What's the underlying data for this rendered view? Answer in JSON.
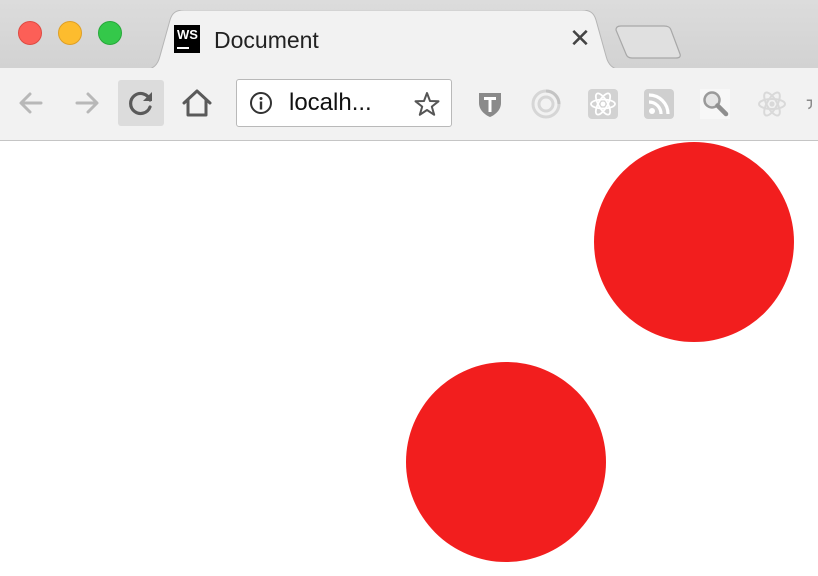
{
  "window": {
    "controls": [
      "close",
      "minimize",
      "maximize"
    ]
  },
  "tab": {
    "favicon_text": "WS",
    "title": "Document",
    "close_glyph": "✕"
  },
  "toolbar": {
    "back_icon": "arrow-left-icon",
    "forward_icon": "arrow-right-icon",
    "reload_icon": "reload-icon",
    "home_icon": "home-icon"
  },
  "omnibox": {
    "url": "localh...",
    "info_icon": "info-icon",
    "bookmark_icon": "star-icon"
  },
  "extensions": [
    "shield-t-icon",
    "ring-icon",
    "react-atom-icon",
    "rss-icon",
    "magnifier-icon",
    "react-atom-faded-icon",
    "cut-off-extension-icon"
  ],
  "page": {
    "circles": [
      {
        "name": "red-circle-top-right",
        "color": "#f21e1e"
      },
      {
        "name": "red-circle-bottom-center",
        "color": "#f21e1e"
      }
    ]
  }
}
